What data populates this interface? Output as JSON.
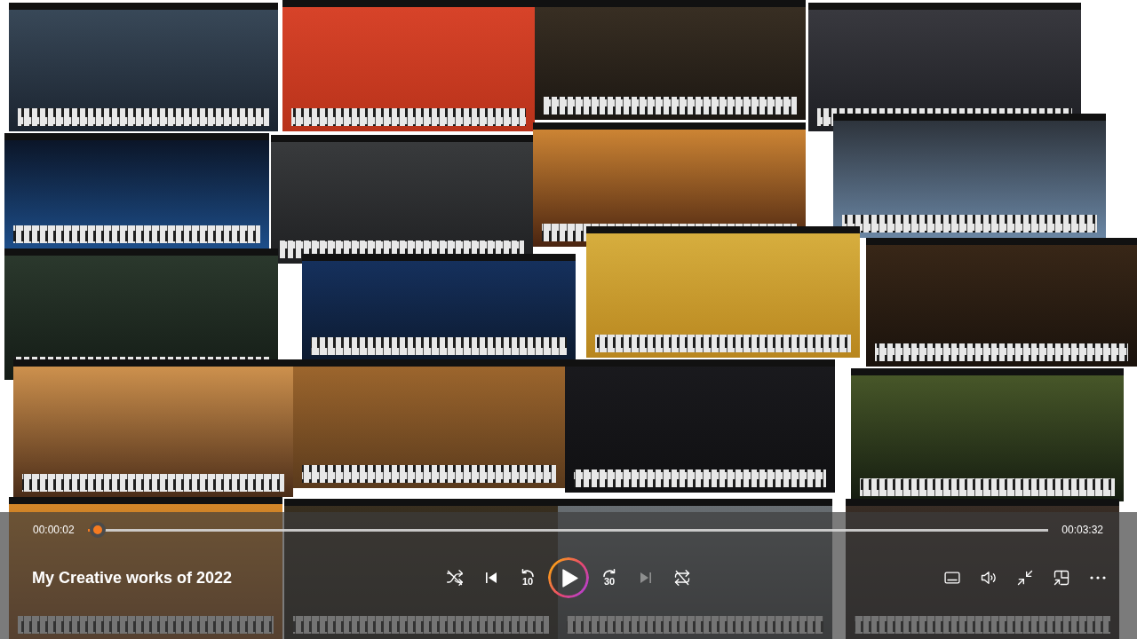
{
  "player": {
    "elapsed": "00:00:02",
    "duration": "00:03:32",
    "progress": {
      "level": 0.01
    },
    "title": "My Creative works of 2022",
    "transport": [
      {
        "kind": "shuffle",
        "on": false,
        "disabled": false
      },
      {
        "kind": "previous",
        "disabled": false
      },
      {
        "kind": "rewind",
        "label": "10",
        "disabled": false
      },
      {
        "kind": "play",
        "playing": false,
        "disabled": false
      },
      {
        "kind": "forward",
        "label": "30",
        "disabled": false
      },
      {
        "kind": "next",
        "disabled": true
      },
      {
        "kind": "repeat",
        "on": false,
        "disabled": false
      }
    ],
    "tools": [
      {
        "kind": "captions"
      },
      {
        "kind": "volume"
      },
      {
        "kind": "exit_fullscreen"
      },
      {
        "kind": "mini_player"
      },
      {
        "kind": "more"
      }
    ]
  }
}
